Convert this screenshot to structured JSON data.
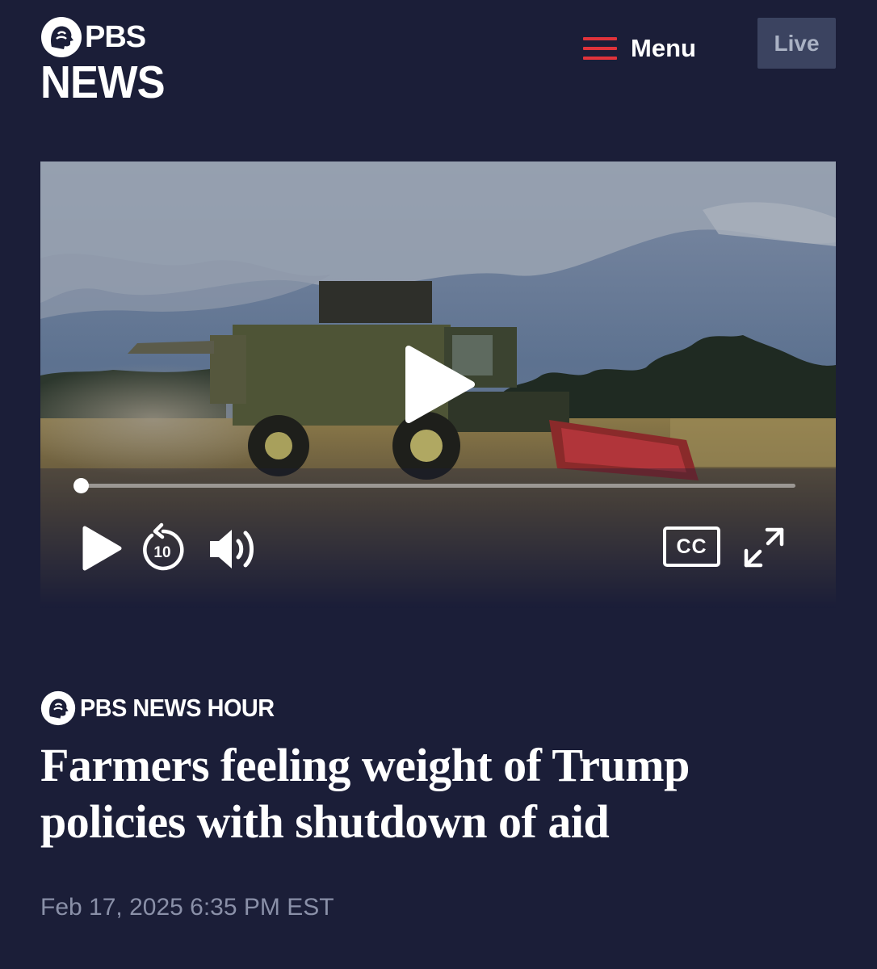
{
  "header": {
    "logo_line1": "PBS",
    "logo_line2": "NEWS",
    "menu_label": "Menu",
    "live_label": "Live"
  },
  "video": {
    "progress_fraction": 0.0,
    "controls": {
      "play_icon": "play-icon",
      "rewind_icon": "rewind-10-icon",
      "rewind_seconds": "10",
      "volume_icon": "volume-icon",
      "captions_label": "CC",
      "fullscreen_icon": "fullscreen-icon"
    }
  },
  "article": {
    "source": "PBS NEWS HOUR",
    "headline": "Farmers feeling weight of Trump policies with shutdown of aid",
    "date": "Feb 17, 2025 6:35 PM EST"
  },
  "colors": {
    "background": "#1b1e38",
    "menu_accent": "#e0333b",
    "live_button": "#3b4360"
  }
}
